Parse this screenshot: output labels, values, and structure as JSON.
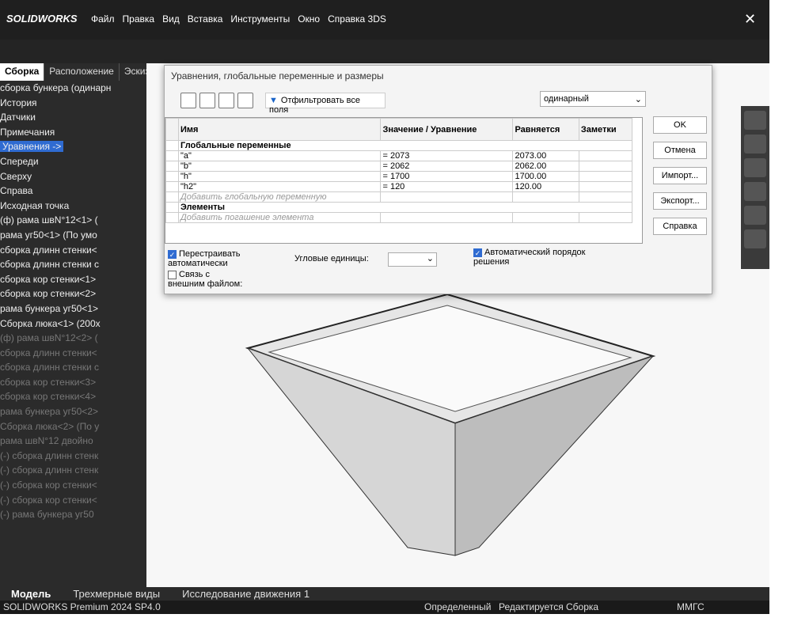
{
  "app": {
    "name": "SOLIDWORKS"
  },
  "menu": [
    "Файл",
    "Правка",
    "Вид",
    "Вставка",
    "Инструменты",
    "Окно",
    "Справка 3DS"
  ],
  "tabs": [
    "Сборка",
    "Расположение",
    "Эскиз"
  ],
  "tree": [
    {
      "label": "сборка бункера (одинарн",
      "dim": false
    },
    {
      "label": "История",
      "dim": false
    },
    {
      "label": "Датчики",
      "dim": false
    },
    {
      "label": "Примечания",
      "dim": false
    },
    {
      "label": "Уравнения ->",
      "dim": false,
      "selected": true
    },
    {
      "label": "Спереди",
      "dim": false
    },
    {
      "label": "Сверху",
      "dim": false
    },
    {
      "label": "Справа",
      "dim": false
    },
    {
      "label": "Исходная точка",
      "dim": false
    },
    {
      "label": "(ф) рама швN°12<1> (",
      "dim": false
    },
    {
      "label": "рама уг50<1> (По умо",
      "dim": false
    },
    {
      "label": "сборка длинн стенки<",
      "dim": false
    },
    {
      "label": "сборка длинн стенки с",
      "dim": false
    },
    {
      "label": "сборка кор стенки<1>",
      "dim": false
    },
    {
      "label": "сборка кор стенки<2>",
      "dim": false
    },
    {
      "label": "рама бункера уг50<1>",
      "dim": false
    },
    {
      "label": "Сборка люка<1> (200x",
      "dim": false
    },
    {
      "label": "(ф) рама швN°12<2> (",
      "dim": true
    },
    {
      "label": "сборка длинн стенки<",
      "dim": true
    },
    {
      "label": "сборка длинн стенки с",
      "dim": true
    },
    {
      "label": "сборка кор стенки<3>",
      "dim": true
    },
    {
      "label": "сборка кор стенки<4>",
      "dim": true
    },
    {
      "label": "рама бункера уг50<2>",
      "dim": true
    },
    {
      "label": "Сборка люка<2> (По у",
      "dim": true
    },
    {
      "label": "рама швN°12 двойно",
      "dim": true
    },
    {
      "label": "(-) сборка длинн стенк",
      "dim": true
    },
    {
      "label": "(-) сборка длинн стенк",
      "dim": true
    },
    {
      "label": "(-) сборка кор стенки<",
      "dim": true
    },
    {
      "label": "(-) сборка кор стенки<",
      "dim": true
    },
    {
      "label": "(-) рама бункера уг50",
      "dim": true
    }
  ],
  "dialog": {
    "title": "Уравнения, глобальные переменные и размеры",
    "filter": "Отфильтровать все поля",
    "unit": "одинарный",
    "headers": [
      "Имя",
      "Значение / Уравнение",
      "Равняется",
      "Заметки"
    ],
    "section_globals": "Глобальные переменные",
    "vars": [
      {
        "name": "\"a\"",
        "eq": "= 2073",
        "val": "2073.00"
      },
      {
        "name": "\"b\"",
        "eq": "= 2062",
        "val": "2062.00"
      },
      {
        "name": "\"h\"",
        "eq": "= 1700",
        "val": "1700.00"
      },
      {
        "name": "\"h2\"",
        "eq": "= 120",
        "val": "120.00"
      }
    ],
    "add_global": "Добавить глобальную переменную",
    "section_elements": "Элементы",
    "add_suppress": "Добавить погашение элемента",
    "buttons": [
      "OK",
      "Отмена",
      "Импорт...",
      "Экспорт...",
      "Справка"
    ],
    "opt_rebuild": "Перестраивать автоматически",
    "opt_link": "Связь с внешним файлом:",
    "angle_label": "Угловые единицы:",
    "opt_order": "Автоматический порядок решения"
  },
  "bottom_tabs": [
    "Модель",
    "Трехмерные виды",
    "Исследование движения 1"
  ],
  "status": {
    "left": "SOLIDWORKS Premium 2024 SP4.0",
    "defined": "Определенный",
    "editing": "Редактируется Сборка",
    "units": "ММГС"
  }
}
